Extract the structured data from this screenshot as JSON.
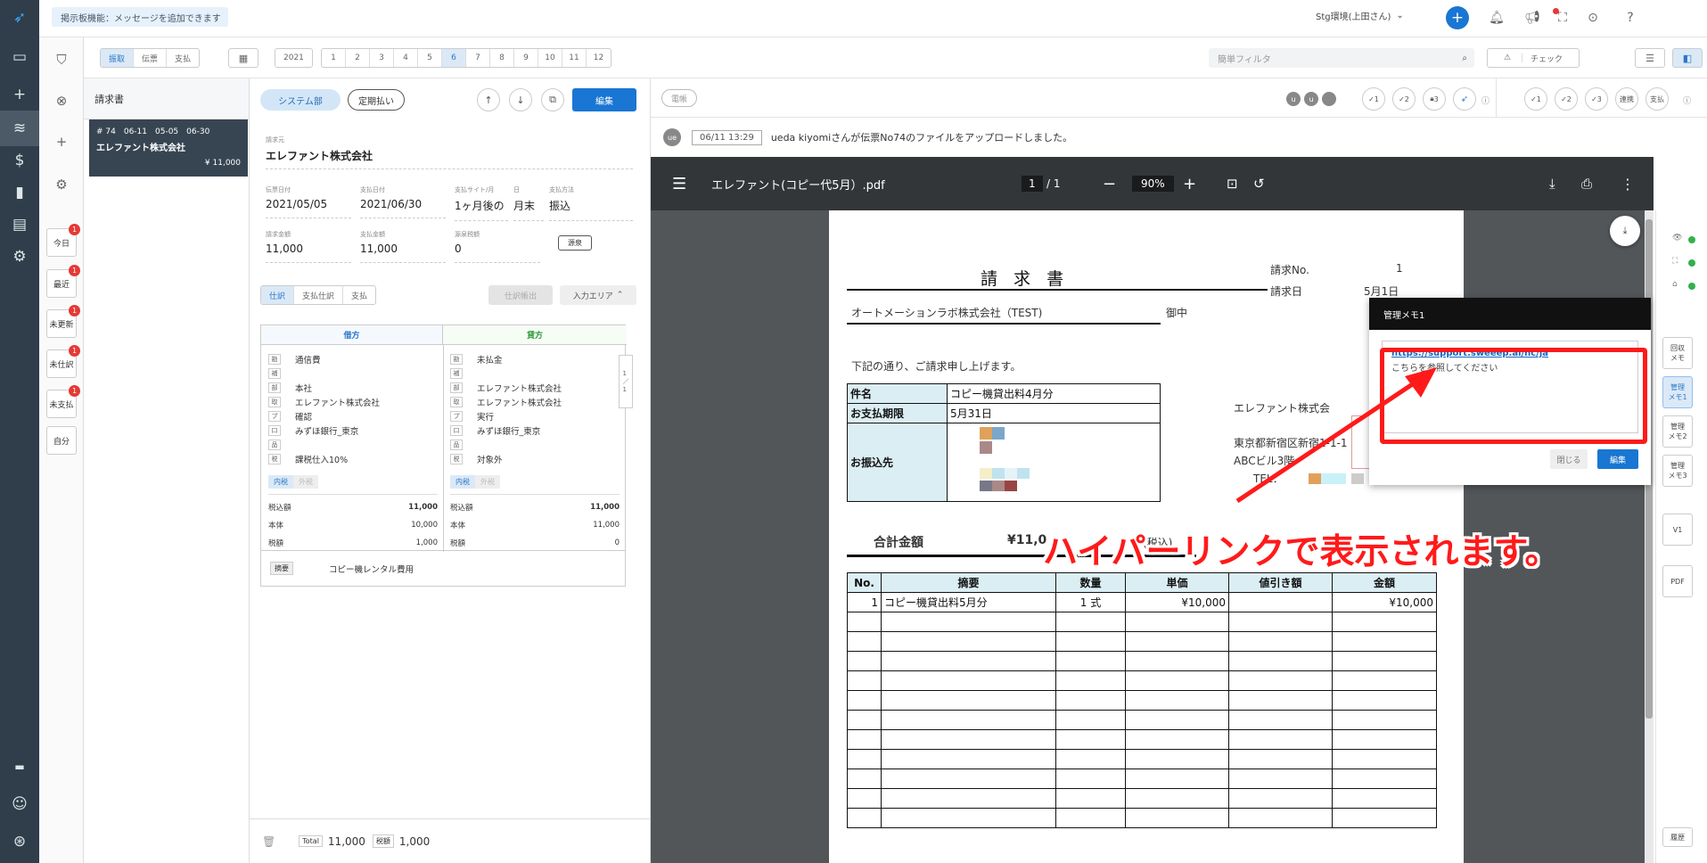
{
  "topbar": {
    "notice": "掲示板機能：メッセージを追加できます",
    "env": "Stg環境(上田さん)"
  },
  "toolbar": {
    "types": [
      "振取",
      "伝票",
      "支払"
    ],
    "year": "2021",
    "months": [
      "1",
      "2",
      "3",
      "4",
      "5",
      "6",
      "7",
      "8",
      "9",
      "10",
      "11",
      "12"
    ],
    "active_month": "6",
    "search_placeholder": "簡単フィルタ",
    "check": "チェック"
  },
  "quick": [
    {
      "label": "今日",
      "badge": "1"
    },
    {
      "label": "最近",
      "badge": "1"
    },
    {
      "label": "未更新",
      "badge": "1"
    },
    {
      "label": "未仕訳",
      "badge": "1"
    },
    {
      "label": "未支払",
      "badge": "1"
    },
    {
      "label": "自分",
      "badge": ""
    }
  ],
  "list": {
    "title": "請求書",
    "card": {
      "line1": "# 74　06-11　05-05　06-30",
      "company": "エレファント株式会社",
      "amount": "¥ 11,000"
    }
  },
  "detail": {
    "pill1": "システム部",
    "pill2": "定期払い",
    "edit": "編集",
    "vendor_label": "請求元",
    "vendor": "エレファント株式会社",
    "fields1": [
      {
        "l": "伝票日付",
        "v": "2021/05/05"
      },
      {
        "l": "支払日付",
        "v": "2021/06/30"
      },
      {
        "l": "支払サイト/月",
        "v": "1ヶ月後の"
      },
      {
        "l": "日",
        "v": "月末"
      },
      {
        "l": "支払方法",
        "v": "振込"
      }
    ],
    "fields2": [
      {
        "l": "請求金額",
        "v": "11,000"
      },
      {
        "l": "支払金額",
        "v": "11,000"
      },
      {
        "l": "源泉税額",
        "v": "0"
      }
    ],
    "gensen": "源泉",
    "tabs": [
      "仕訳",
      "支払仕訳",
      "支払"
    ],
    "export": "仕訳帳出",
    "input_area": "入力エリア",
    "debit": {
      "title": "借方",
      "rows": [
        [
          "勘",
          "通信費"
        ],
        [
          "補",
          ""
        ],
        [
          "部",
          "本社"
        ],
        [
          "取",
          "エレファント株式会社"
        ],
        [
          "プ",
          "確認"
        ],
        [
          "口",
          "みずほ銀行_東京"
        ],
        [
          "品",
          ""
        ],
        [
          "税",
          "課税仕入10%"
        ]
      ],
      "tax_in": "内税",
      "tax_out": "外税",
      "totals": [
        [
          "税込額",
          "11,000"
        ],
        [
          "本体",
          "10,000"
        ],
        [
          "税額",
          "1,000"
        ]
      ]
    },
    "credit": {
      "title": "貸方",
      "rows": [
        [
          "勘",
          "未払金"
        ],
        [
          "補",
          ""
        ],
        [
          "部",
          "エレファント株式会社"
        ],
        [
          "取",
          "エレファント株式会社"
        ],
        [
          "プ",
          "実行"
        ],
        [
          "口",
          "みずほ銀行_東京"
        ],
        [
          "品",
          ""
        ],
        [
          "税",
          "対象外"
        ]
      ],
      "tax_in": "内税",
      "tax_out": "外税",
      "totals": [
        [
          "税込額",
          "11,000"
        ],
        [
          "本体",
          "11,000"
        ],
        [
          "税額",
          "0"
        ]
      ]
    },
    "memo_label": "摘要",
    "memo": "コピー機レンタル費用",
    "footer": {
      "total_label": "Total",
      "total": "11,000",
      "tax_label": "税額",
      "tax": "1,000"
    }
  },
  "right": {
    "tab": "電帳",
    "avatars": [
      "u",
      "u",
      ""
    ],
    "log_user": "ue",
    "log_time": "06/11 13:29",
    "log_text": "ueda kiyomiさんが伝票No74のファイルをアップロードしました。",
    "steps1": [
      "1",
      "2",
      "3"
    ],
    "steps2": [
      "1",
      "2",
      "3",
      "連携",
      "支払"
    ],
    "pdf": {
      "name": "エレファント(コピー代5月）.pdf",
      "page": "1",
      "pages": "1",
      "zoom": "90%"
    }
  },
  "doc": {
    "title": "請 求 書",
    "no_label": "請求No.",
    "no": "1",
    "date_label": "請求日",
    "date": "5月1日",
    "to": "オートメーションラボ株式会社（TEST)",
    "honorific": "御中",
    "lead": "下記の通り、ご請求申し上げます。",
    "subject_label": "件名",
    "subject": "コピー機貸出料4月分",
    "due_label": "お支払期限",
    "due": "5月31日",
    "bank_label": "お振込先",
    "seller": "エレファント株式会",
    "address": "東京都新宿区新宿1-1-1",
    "building": "ABCビル3階",
    "tel": "TEL：",
    "total_label": "合計金額",
    "total": "¥11,0",
    "tax_note": "(税込)",
    "cols": [
      "No.",
      "摘要",
      "数量",
      "単価",
      "値引き額",
      "金額"
    ],
    "row1": [
      "1",
      "コピー機貸出料5月分",
      "1 式",
      "¥10,000",
      "",
      "¥10,000"
    ]
  },
  "memo": {
    "title": "管理メモ1",
    "link": "https://support.sweeep.ai/hc/ja",
    "text": "こちらを参照してください",
    "close": "閉じる",
    "edit": "編集"
  },
  "annotation": "ハイパーリンクで表示されます。",
  "side": [
    "回収\nメモ",
    "管理\nメモ1",
    "管理\nメモ2",
    "管理\nメモ3",
    "V1",
    "PDF",
    "履歴"
  ]
}
